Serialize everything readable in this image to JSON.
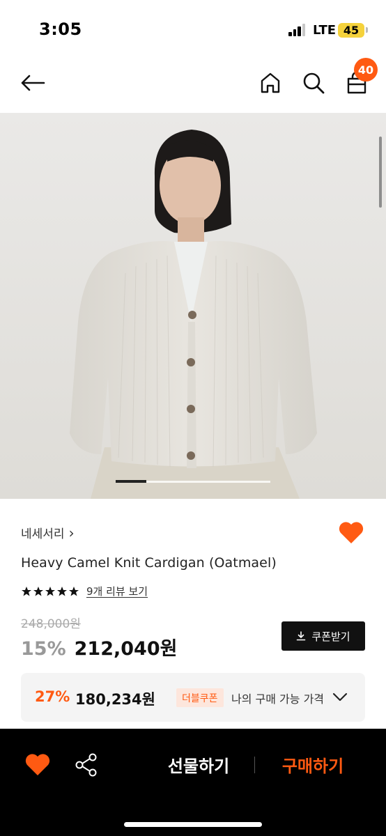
{
  "status_bar": {
    "time": "3:05",
    "network": "LTE",
    "battery": "45"
  },
  "nav": {
    "back_icon": "arrow-left-icon",
    "home_icon": "home-icon",
    "search_icon": "search-icon",
    "cart_icon": "shopping-bag-icon",
    "cart_badge": "40"
  },
  "gallery": {
    "current_index": 1,
    "progress_fraction": 0.2
  },
  "product": {
    "brand": "네세서리",
    "brand_chevron": "›",
    "name": "Heavy Camel Knit Cardigan (Oatmael)",
    "rating_stars": 5,
    "review_link": "9개 리뷰 보기",
    "original_price": "248,000원",
    "discount_rate": "15%",
    "sale_price": "212,040원",
    "coupon_button": "쿠폰받기",
    "liked": true
  },
  "my_price": {
    "discount_rate": "27%",
    "price": "180,234원",
    "tag": "더블쿠폰",
    "label": "나의 구매 가능 가격"
  },
  "bottom_bar": {
    "gift_label": "선물하기",
    "buy_label": "구매하기"
  },
  "colors": {
    "accent": "#ff5a12",
    "dark": "#000000",
    "battery": "#f5d23c"
  }
}
